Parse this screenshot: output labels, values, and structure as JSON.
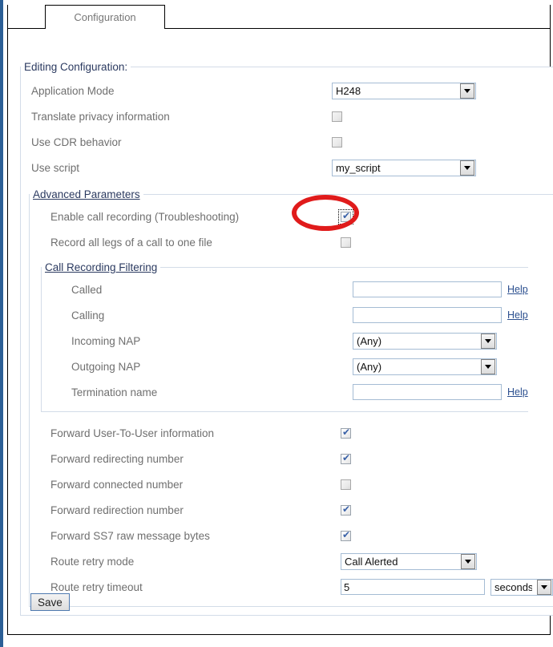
{
  "tabs": [
    {
      "label": "Configuration",
      "active": true
    }
  ],
  "form": {
    "legend": "Editing Configuration:",
    "application_mode": {
      "label": "Application Mode",
      "value": "H248"
    },
    "translate_privacy": {
      "label": "Translate privacy information",
      "checked": false,
      "disabled": true
    },
    "use_cdr_behavior": {
      "label": "Use CDR behavior",
      "checked": false,
      "disabled": true
    },
    "use_script": {
      "label": "Use script",
      "value": "my_script"
    }
  },
  "advanced": {
    "legend": "Advanced Parameters",
    "enable_call_recording": {
      "label": "Enable call recording (Troubleshooting)",
      "checked": true,
      "focused": true
    },
    "record_all_legs": {
      "label": "Record all legs of a call to one file",
      "checked": false,
      "disabled": true
    },
    "forward_user_to_user": {
      "label": "Forward User-To-User information",
      "checked": true
    },
    "forward_redirecting_number": {
      "label": "Forward redirecting number",
      "checked": true
    },
    "forward_connected_number": {
      "label": "Forward connected number",
      "checked": false,
      "disabled": true
    },
    "forward_redirection_number": {
      "label": "Forward redirection number",
      "checked": true
    },
    "forward_ss7_raw": {
      "label": "Forward SS7 raw message bytes",
      "checked": true
    },
    "route_retry_mode": {
      "label": "Route retry mode",
      "value": "Call Alerted"
    },
    "route_retry_timeout": {
      "label": "Route retry timeout",
      "value": "5",
      "unit": "seconds"
    }
  },
  "filtering": {
    "legend": "Call Recording Filtering",
    "called": {
      "label": "Called",
      "value": "",
      "help": "Help"
    },
    "calling": {
      "label": "Calling",
      "value": "",
      "help": "Help"
    },
    "incoming_nap": {
      "label": "Incoming NAP",
      "value": "(Any)"
    },
    "outgoing_nap": {
      "label": "Outgoing NAP",
      "value": "(Any)"
    },
    "termination_name": {
      "label": "Termination name",
      "value": "",
      "help": "Help"
    }
  },
  "actions": {
    "save": "Save"
  },
  "annotation": {
    "type": "ellipse-highlight",
    "color": "#e01b1b",
    "target": "enable-call-recording-checkbox"
  },
  "icons": {
    "dropdown": "chevron-down-icon",
    "check": "✔"
  }
}
